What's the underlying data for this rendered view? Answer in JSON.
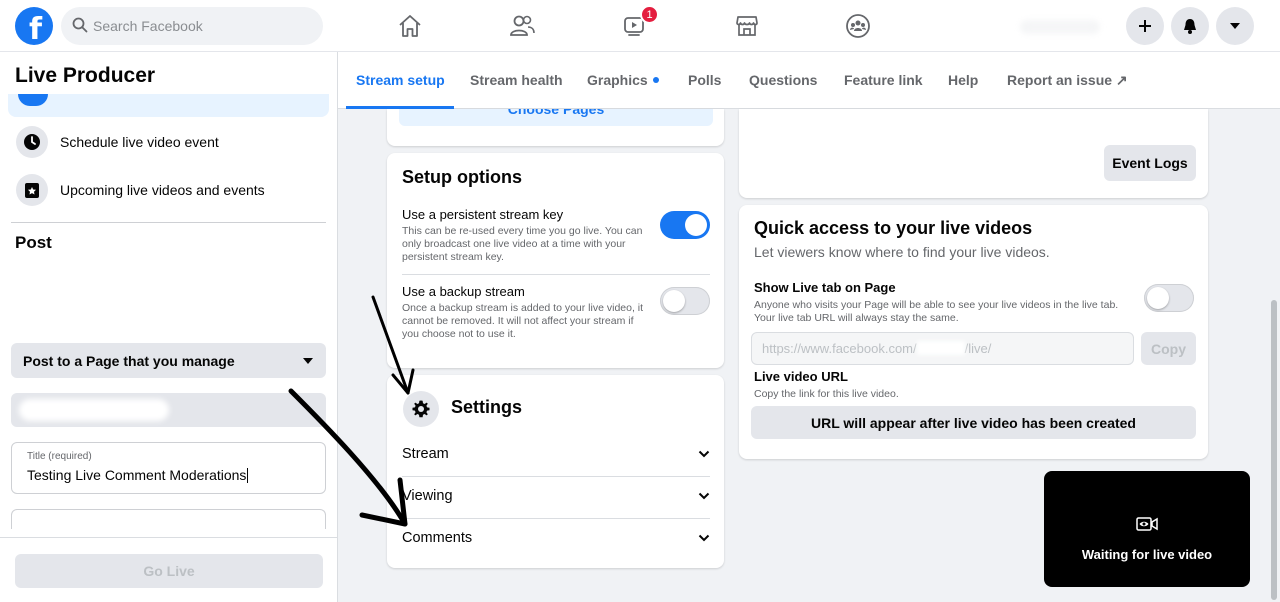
{
  "topbar": {
    "logo": "f",
    "search_placeholder": "Search Facebook",
    "nav_icons": [
      "home-icon",
      "friends-icon",
      "watch-icon",
      "marketplace-icon",
      "groups-icon"
    ],
    "watch_badge": "1",
    "right_buttons": [
      "plus-icon",
      "messenger-icon",
      "caret-down-icon"
    ]
  },
  "sidebar": {
    "title": "Live Producer",
    "items": [
      {
        "label": "Schedule live video event",
        "icon": "clock-icon"
      },
      {
        "label": "Upcoming live videos and events",
        "icon": "calendar-star-icon"
      }
    ],
    "post_heading": "Post",
    "post_dropdown": "Post to a Page that you manage",
    "title_field": {
      "label": "Title (required)",
      "value": "Testing Live Comment Moderations"
    },
    "go_live": "Go Live"
  },
  "tabs": [
    {
      "label": "Stream setup",
      "active": true
    },
    {
      "label": "Stream health"
    },
    {
      "label": "Graphics"
    },
    {
      "label": "Polls"
    },
    {
      "label": "Questions"
    },
    {
      "label": "Feature link"
    },
    {
      "label": "Help"
    },
    {
      "label": "Report an issue ↗"
    }
  ],
  "choose_pages": "Choose Pages",
  "setup_options": {
    "title": "Setup options",
    "persistent": {
      "title": "Use a persistent stream key",
      "desc": "This can be re-used every time you go live. You can only broadcast one live video at a time with your persistent stream key.",
      "on": true
    },
    "backup": {
      "title": "Use a backup stream",
      "desc": "Once a backup stream is added to your live video, it cannot be removed. It will not affect your stream if you choose not to use it.",
      "on": false
    }
  },
  "settings": {
    "title": "Settings",
    "rows": [
      "Stream",
      "Viewing",
      "Comments"
    ]
  },
  "event_logs": "Event Logs",
  "quick_access": {
    "title": "Quick access to your live videos",
    "subtitle": "Let viewers know where to find your live videos.",
    "show_tab_title": "Show Live tab on Page",
    "show_tab_desc": "Anyone who visits your Page will be able to see your live videos in the live tab. Your live tab URL will always stay the same.",
    "show_tab_on": false,
    "url_prefix": "https://www.facebook.com/",
    "url_suffix": "/live/",
    "copy": "Copy",
    "live_url_title": "Live video URL",
    "live_url_desc": "Copy the link for this live video.",
    "url_appear": "URL will appear after live video has been created"
  },
  "preview": {
    "text": "Waiting for live video",
    "icon": "video-eye-icon"
  },
  "colors": {
    "accent": "#1877f2",
    "badge": "#e41e3f",
    "bg": "#f0f2f5"
  }
}
